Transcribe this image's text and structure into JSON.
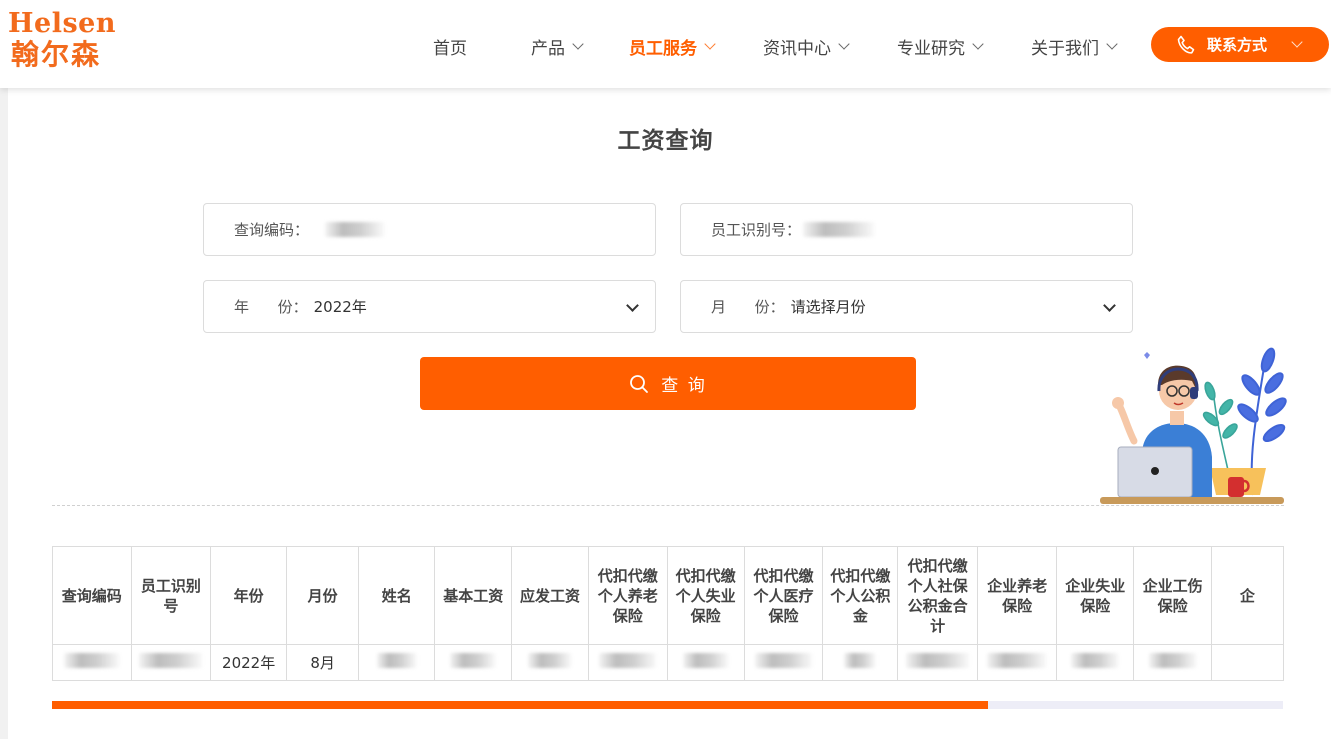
{
  "brand": {
    "name_en": "Helsen",
    "name_cn": "翰尔森"
  },
  "nav": {
    "items": [
      {
        "label": "首页",
        "has_dropdown": false,
        "active": false
      },
      {
        "label": "产品",
        "has_dropdown": true,
        "active": false
      },
      {
        "label": "员工服务",
        "has_dropdown": true,
        "active": true
      },
      {
        "label": "资讯中心",
        "has_dropdown": true,
        "active": false
      },
      {
        "label": "专业研究",
        "has_dropdown": true,
        "active": false
      },
      {
        "label": "关于我们",
        "has_dropdown": true,
        "active": false
      }
    ],
    "contact_label": "联系方式"
  },
  "page": {
    "title": "工资查询"
  },
  "form": {
    "query_code_label": "查询编码：",
    "employee_id_label": "员工识别号：",
    "year_label": "年      份：",
    "year_value": "2022年",
    "month_label": "月      份：",
    "month_placeholder": "请选择月份",
    "search_label": "查 询"
  },
  "table": {
    "headers": [
      "查询编码",
      "员工识别号",
      "年份",
      "月份",
      "姓名",
      "基本工资",
      "应发工资",
      "代扣代缴个人养老保险",
      "代扣代缴个人失业保险",
      "代扣代缴个人医疗保险",
      "代扣代缴个人公积金",
      "代扣代缴个人社保公积金合计",
      "企业养老保险",
      "企业失业保险",
      "企业工伤保险",
      "企"
    ],
    "rows": [
      {
        "year": "2022年",
        "month": "8月"
      }
    ]
  },
  "scroll": {
    "position_fraction": 0.76
  },
  "colors": {
    "accent": "#ff5e00"
  }
}
